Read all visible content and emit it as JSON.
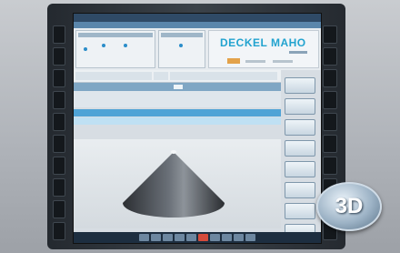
{
  "window": {
    "title": "",
    "status": ""
  },
  "brand": {
    "logo_text": "DECKEL MAHO"
  },
  "badge": {
    "label": "3D"
  },
  "softkeys": [
    "",
    "",
    "",
    "",
    "",
    "",
    "",
    ""
  ],
  "bottom_keys": [
    "",
    "",
    "",
    "",
    "",
    "",
    "",
    "",
    "",
    ""
  ],
  "colors": {
    "logo": "#22a3cf",
    "active_row": "#4fa3d6",
    "highlight_key": "#d44b3b",
    "screen_frame": "#2f4a66"
  },
  "graphic": {
    "shape": "cone",
    "view": "3d"
  }
}
